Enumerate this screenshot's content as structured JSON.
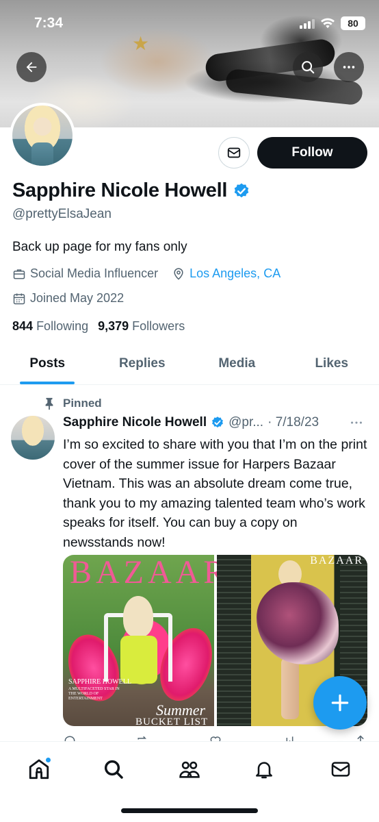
{
  "status_bar": {
    "time": "7:34",
    "battery": "80"
  },
  "banner": {
    "back_icon": "arrow-left-icon",
    "search_icon": "search-icon",
    "more_icon": "more-horizontal-icon"
  },
  "profile": {
    "name": "Sapphire Nicole Howell",
    "handle": "@prettyElsaJean",
    "bio": "Back up page for my fans only",
    "category": "Social Media Influencer",
    "location": "Los Angeles, CA",
    "joined": "Joined May 2022",
    "following_count": "844",
    "following_label": "Following",
    "followers_count": "9,379",
    "followers_label": "Followers",
    "follow_label": "Follow",
    "verified": true
  },
  "tabs": [
    {
      "label": "Posts",
      "active": true
    },
    {
      "label": "Replies",
      "active": false
    },
    {
      "label": "Media",
      "active": false
    },
    {
      "label": "Likes",
      "active": false
    }
  ],
  "post": {
    "pinned_label": "Pinned",
    "author_name": "Sapphire Nicole Howell",
    "author_handle_truncated": "@pr...",
    "date": "· 7/18/23",
    "text": "I’m so excited to share with you that I’m on the print cover of the summer issue for Harpers Bazaar Vietnam. This was an absolute dream come true, thank you to my amazing talented team who’s work speaks for itself. You can buy a copy on newsstands now!",
    "media": [
      {
        "cover_title": "BAZAAR",
        "cover_name": "SAPPHIRE HOWELL",
        "cover_tagline": "A MULTIFACETED STAR IN THE WORLD OF ENTERTAINMENT",
        "cover_sub": "Summer",
        "cover_sub2": "BUCKET LIST"
      },
      {
        "brand": "BAZAAR"
      }
    ]
  },
  "bottom_nav": [
    {
      "icon": "home-icon"
    },
    {
      "icon": "search-icon"
    },
    {
      "icon": "communities-icon"
    },
    {
      "icon": "bell-icon"
    },
    {
      "icon": "mail-icon"
    }
  ],
  "colors": {
    "accent": "#1d9bf0",
    "text": "#0f1419",
    "secondary": "#536471"
  }
}
